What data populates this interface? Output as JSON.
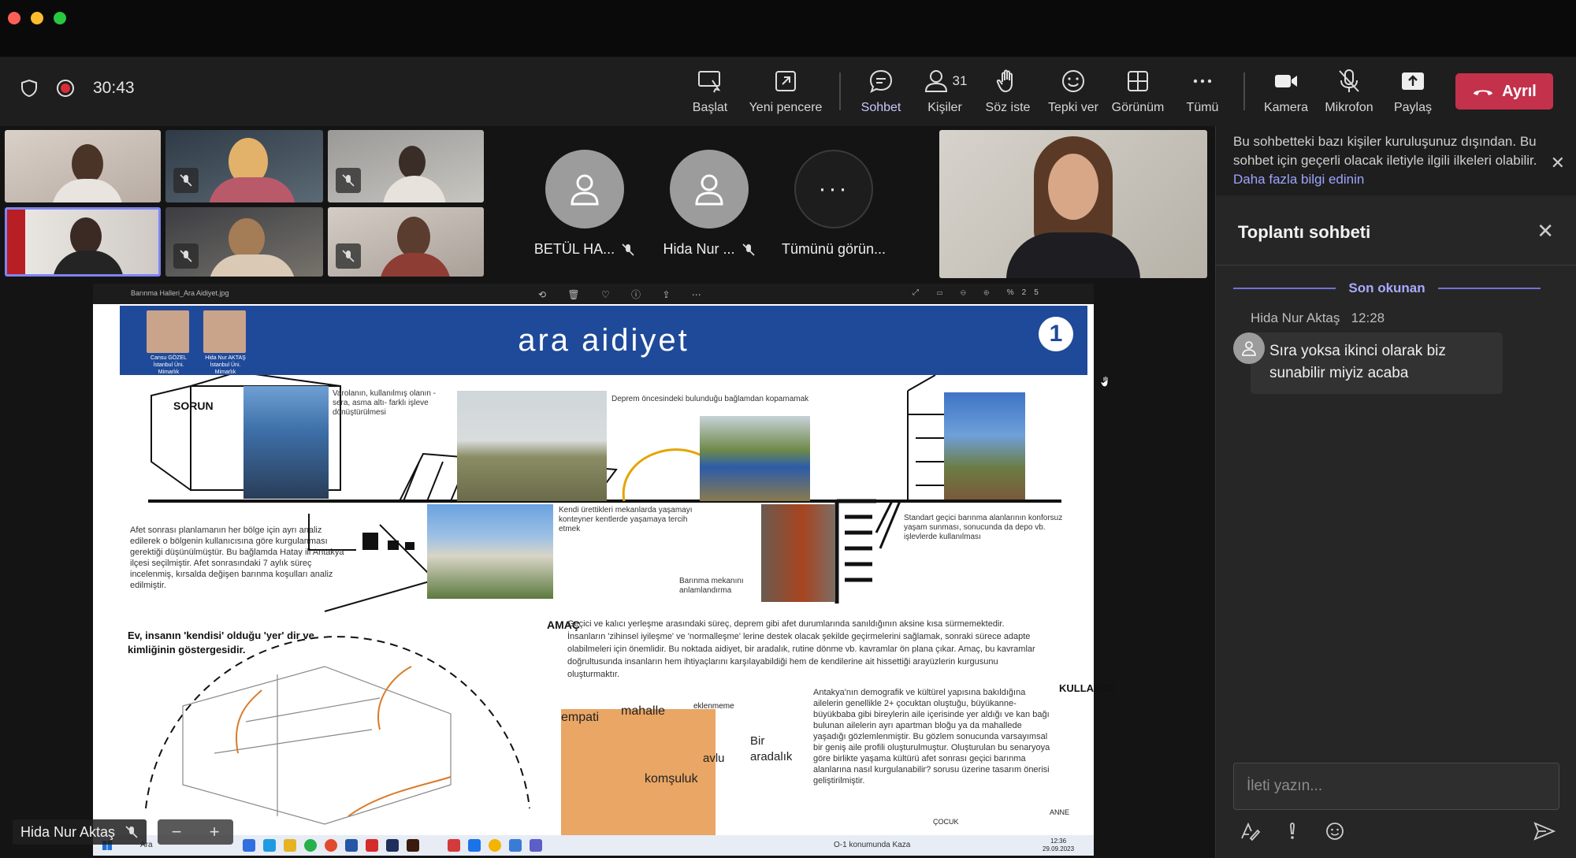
{
  "meeting": {
    "timer": "30:43",
    "leave_label": "Ayrıl",
    "participant_count": "31",
    "tools": [
      {
        "id": "start",
        "label": "Başlat"
      },
      {
        "id": "new-window",
        "label": "Yeni pencere"
      },
      {
        "id": "chat",
        "label": "Sohbet"
      },
      {
        "id": "people",
        "label": "Kişiler"
      },
      {
        "id": "raise-hand",
        "label": "Söz iste"
      },
      {
        "id": "react",
        "label": "Tepki ver"
      },
      {
        "id": "view",
        "label": "Görünüm"
      },
      {
        "id": "more",
        "label": "Tümü"
      },
      {
        "id": "camera",
        "label": "Kamera"
      },
      {
        "id": "mic",
        "label": "Mikrofon"
      },
      {
        "id": "share",
        "label": "Paylaş"
      }
    ]
  },
  "gallery": {
    "avatar_tiles": [
      {
        "name": "BETÜL HA..."
      },
      {
        "name": "Hida Nur ..."
      }
    ],
    "more_label": "Tümünü görün...",
    "more_glyph": "···"
  },
  "shared_content": {
    "file_name": "Barınma Halleri_Ara Aidiyet.jpg",
    "zoom": "%25",
    "poster_title": "ara aidiyet",
    "badge": "1",
    "authors": [
      "Cansu GÖZEL İstanbul Üni. Mimarlık",
      "Hida Nur AKTAŞ İstanbul Üni. Mimarlık"
    ],
    "sorun_letters": "SORUN",
    "amac_letters": "AMAÇ",
    "kullanici_letters": "KULLANICI",
    "texts": {
      "t1": "Varolanın, kullanılmış olanın -sera, asma altı- farklı işleve dönüştürülmesi",
      "t2": "Deprem öncesindeki bulunduğu bağlamdan kopamamak",
      "t3": "Kendi ürettikleri mekanlarda yaşamayı konteyner kentlerde yaşamaya tercih etmek",
      "t4": "Standart geçici barınma alanlarının konforsuz yaşam sunması, sonucunda da depo vb. işlevlerde kullanılması",
      "t5": "Barınma mekanını anlamlandırma",
      "t6": "Afet sonrası planlamanın her bölge için ayrı analiz edilerek o bölgenin kullanıcısına göre kurgulanması gerektiği düşünülmüştür. Bu bağlamda Hatay ili Antakya ilçesi seçilmiştir. Afet sonrasındaki 7 aylık süreç incelenmiş, kırsalda değişen barınma koşulları analiz edilmiştir.",
      "t7": "Ev, insanın 'kendisi' olduğu 'yer' dir ve kimliğinin göstergesidir.",
      "t8": "Geçici ve kalıcı yerleşme arasındaki süreç, deprem gibi afet durumlarında sanıldığının aksine kısa sürmemektedir. İnsanların 'zihinsel iyileşme' ve 'normalleşme' lerine destek olacak şekilde geçirmelerini sağlamak, sonraki sürece adapte olabilmeleri için önemlidir. Bu noktada aidiyet, bir aradalık, rutine dönme vb. kavramlar ön plana çıkar. Amaç, bu kavramlar doğrultusunda insanların hem ihtiyaçlarını karşılayabildiği hem de kendilerine ait hissettiği arayüzlerin kurgusunu oluşturmaktır.",
      "t9": "Antakya'nın demografik ve kültürel yapısına bakıldığına ailelerin genellikle 2+ çocuktan oluştuğu, büyükanne-büyükbaba gibi bireylerin aile içerisinde yer aldığı ve kan bağı bulunan ailelerin ayrı apartman bloğu ya da mahallede yaşadığı gözlemlenmiştir. Bu gözlem sonucunda varsayımsal bir geniş aile profili oluşturulmuştur. Oluşturulan bu senaryoya göre birlikte yaşama kültürü afet sonrası geçici barınma alanlarına nasıl kurgulanabilir? sorusu üzerine tasarım önerisi geliştirilmiştir.",
      "w_empati": "empati",
      "w_mahalle": "mahalle",
      "w_eklenmeme": "eklenmeme",
      "w_bir": "Bir",
      "w_aradalik": "aradalık",
      "w_avlu": "avlu",
      "w_komsuluk": "komşuluk",
      "w_cocuk": "ÇOCUK",
      "w_anne": "ANNE"
    }
  },
  "taskbar": {
    "search": "Ara",
    "location": "O-1 konumunda Kaza",
    "time": "12:36",
    "date": "29.09.2023"
  },
  "speaker_tag": "Hida Nur Aktaş",
  "chat": {
    "notice_text": "Bu sohbetteki bazı kişiler kuruluşunuz dışından. Bu sohbet için geçerli olacak iletiyle ilgili ilkeleri olabilir.",
    "notice_link": "Daha fazla bilgi edinin",
    "title": "Toplantı sohbeti",
    "last_read": "Son okunan",
    "message": {
      "author": "Hida Nur Aktaş",
      "time": "12:28",
      "text": "Sıra yoksa ikinci olarak biz sunabilir miyiz acaba"
    },
    "compose_placeholder": "İleti yazın..."
  },
  "colors": {
    "accent": "#8b8cf0",
    "leave": "#c4314b",
    "poster_blue": "#1f4a9a",
    "orange": "#d97b2b"
  }
}
